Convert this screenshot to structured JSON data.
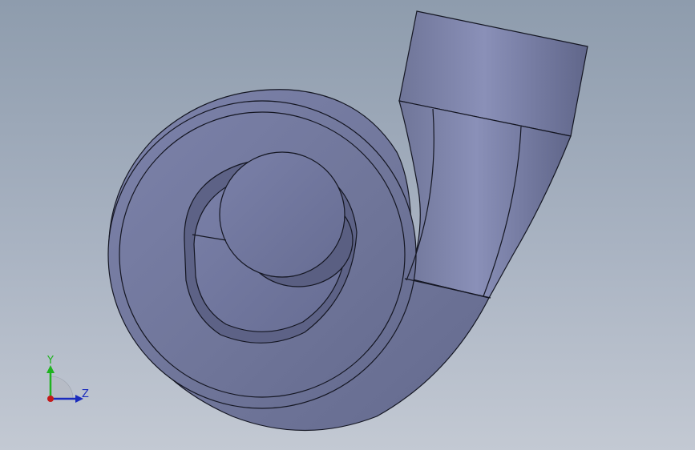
{
  "viewport": {
    "model": "volute-casing",
    "background_top": "#8e9cad",
    "background_bottom": "#c3c9d3",
    "body_color": "#747aa3",
    "edge_color": "#141622"
  },
  "triad": {
    "y_label": "Y",
    "z_label": "Z",
    "y_color": "#1fb31f",
    "z_color": "#1a2bbd",
    "x_color": "#c41a1a"
  }
}
